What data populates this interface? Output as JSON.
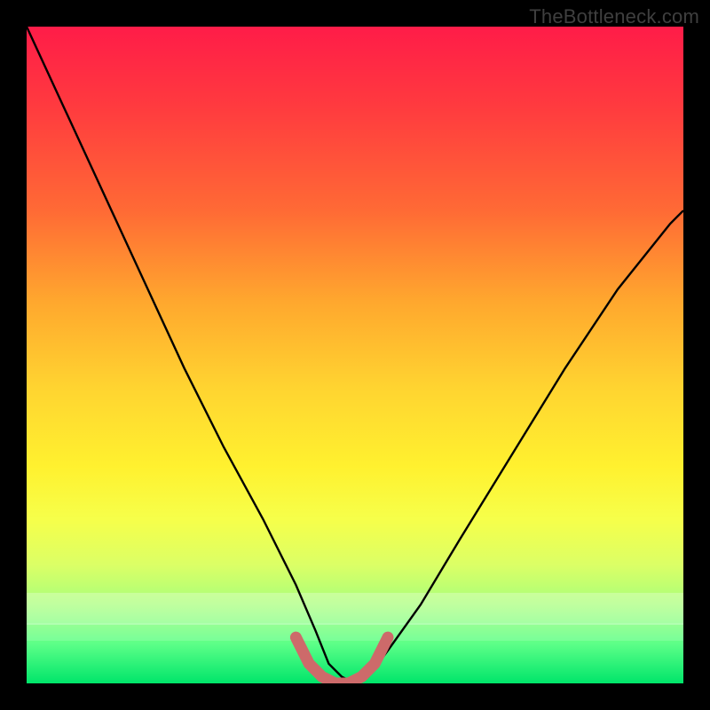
{
  "watermark": {
    "text": "TheBottleneck.com"
  },
  "chart_data": {
    "type": "line",
    "title": "",
    "xlabel": "",
    "ylabel": "",
    "xlim": [
      0,
      100
    ],
    "ylim": [
      0,
      100
    ],
    "grid": false,
    "series": [
      {
        "name": "bottleneck-curve",
        "x": [
          0,
          6,
          12,
          18,
          24,
          30,
          36,
          41,
          44,
          46,
          48,
          50,
          52,
          55,
          60,
          66,
          74,
          82,
          90,
          98,
          100
        ],
        "values": [
          100,
          87,
          74,
          61,
          48,
          36,
          25,
          15,
          8,
          3,
          1,
          0,
          1,
          5,
          12,
          22,
          35,
          48,
          60,
          70,
          72
        ]
      },
      {
        "name": "flat-bottom-marker",
        "x": [
          41,
          43,
          45,
          47,
          49,
          51,
          53,
          55
        ],
        "values": [
          7,
          3,
          1,
          0,
          0,
          1,
          3,
          7
        ]
      }
    ],
    "annotations": [],
    "legend": {
      "visible": false
    }
  },
  "colors": {
    "curve": "#000000",
    "marker": "#cd6a6a",
    "bg_top": "#ff1c48",
    "bg_bottom": "#00e56a"
  }
}
